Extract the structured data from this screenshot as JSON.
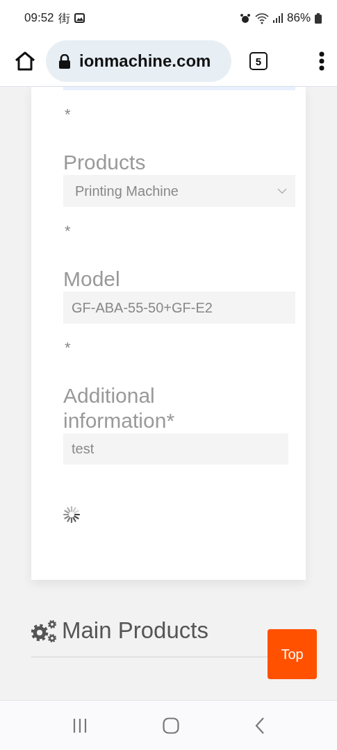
{
  "status_bar": {
    "time": "09:52",
    "notification": "街",
    "battery": "86%"
  },
  "browser": {
    "url": "ionmachine.com",
    "tab_count": "5"
  },
  "form": {
    "fields": [
      {
        "kind": "cut",
        "note": "*"
      },
      {
        "kind": "select",
        "label": "Products",
        "value": "Printing Machine",
        "note": "*"
      },
      {
        "kind": "input",
        "label": "Model",
        "value": "GF-ABA-55-50+GF-E2",
        "note": "*"
      },
      {
        "kind": "textarea",
        "label": "Additional information*",
        "value": "test"
      }
    ]
  },
  "section": {
    "title": "Main Products"
  },
  "top_button": "Top"
}
